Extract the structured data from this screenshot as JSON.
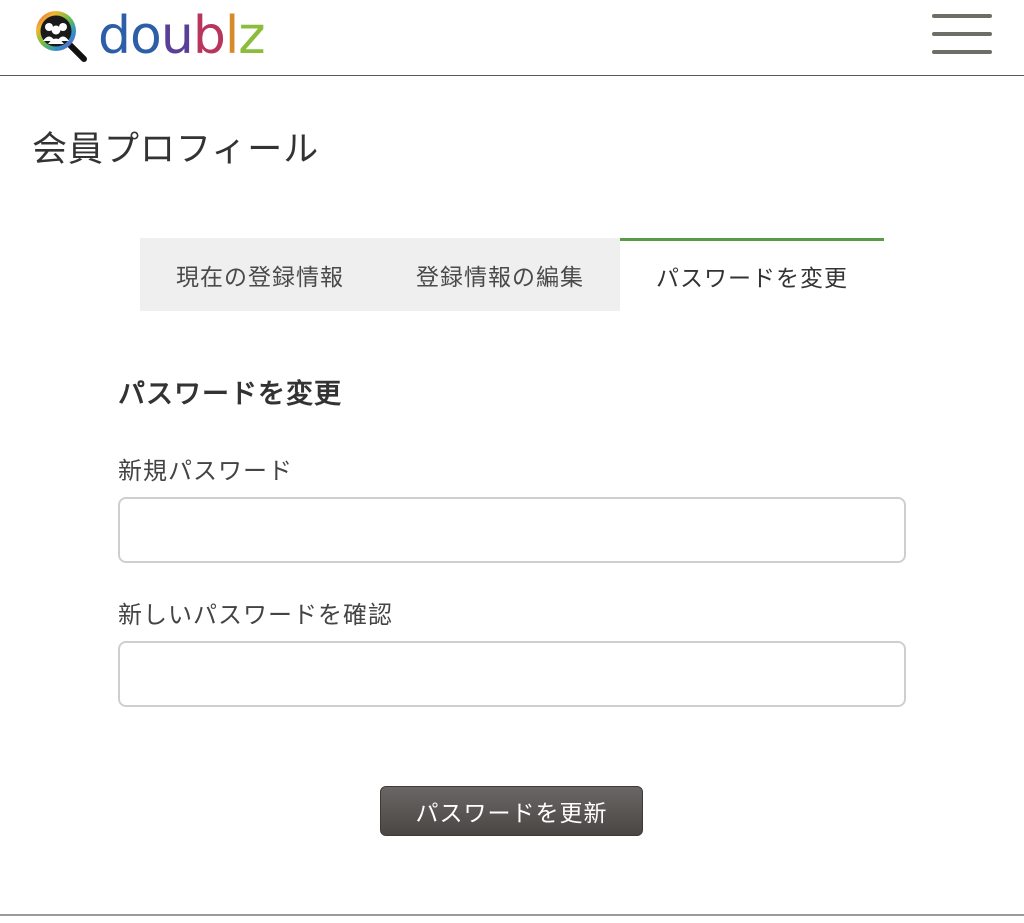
{
  "header": {
    "logo_text": "doublz",
    "logo_gradient": [
      "#2d5fa8",
      "#5a3f98",
      "#b8365d",
      "#d88a2b",
      "#8bbd3a"
    ],
    "menu_icon": "hamburger-menu-icon",
    "logo_icon": "magnifier-people-icon"
  },
  "page": {
    "title": "会員プロフィール"
  },
  "tabs": [
    {
      "label": "現在の登録情報",
      "active": false
    },
    {
      "label": "登録情報の編集",
      "active": false
    },
    {
      "label": "パスワードを変更",
      "active": true
    }
  ],
  "form": {
    "section_title": "パスワードを変更",
    "new_password": {
      "label": "新規パスワード",
      "value": "",
      "placeholder": ""
    },
    "confirm_password": {
      "label": "新しいパスワードを確認",
      "value": "",
      "placeholder": ""
    },
    "submit_label": "パスワードを更新"
  },
  "colors": {
    "active_tab_accent": "#5b9a46",
    "tab_inactive_bg": "#efefef",
    "button_bg": "#5a5653"
  }
}
